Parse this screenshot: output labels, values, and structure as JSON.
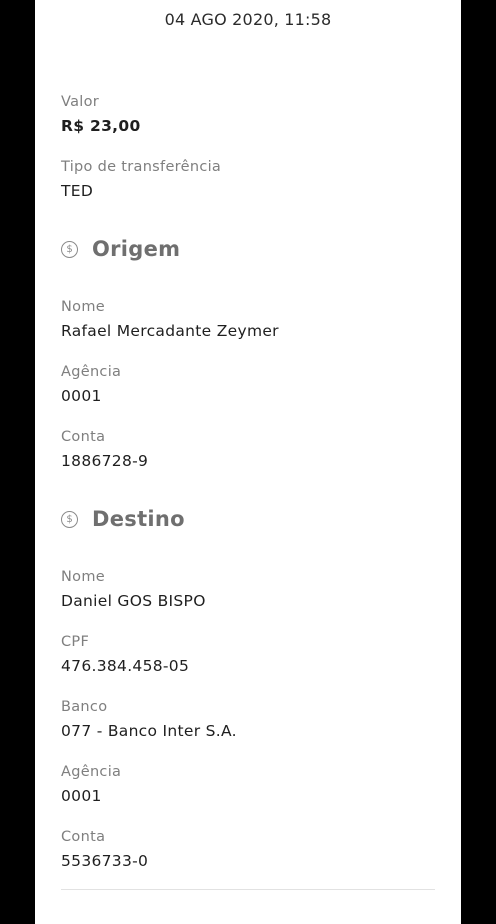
{
  "header": {
    "datetime": "04 AGO 2020, 11:58"
  },
  "transfer": {
    "valor_label": "Valor",
    "valor_value": "R$ 23,00",
    "tipo_label": "Tipo de transferência",
    "tipo_value": "TED"
  },
  "origem": {
    "title": "Origem",
    "icon": "dollar-circle-icon",
    "nome_label": "Nome",
    "nome_value": "Rafael Mercadante Zeymer",
    "agencia_label": "Agência",
    "agencia_value": "0001",
    "conta_label": "Conta",
    "conta_value": "1886728-9"
  },
  "destino": {
    "title": "Destino",
    "icon": "dollar-circle-icon",
    "nome_label": "Nome",
    "nome_value": "Daniel GOS BISPO",
    "cpf_label": "CPF",
    "cpf_value": "476.384.458-05",
    "banco_label": "Banco",
    "banco_value": "077 - Banco Inter S.A.",
    "agencia_label": "Agência",
    "agencia_value": "0001",
    "conta_label": "Conta",
    "conta_value": "5536733-0"
  }
}
